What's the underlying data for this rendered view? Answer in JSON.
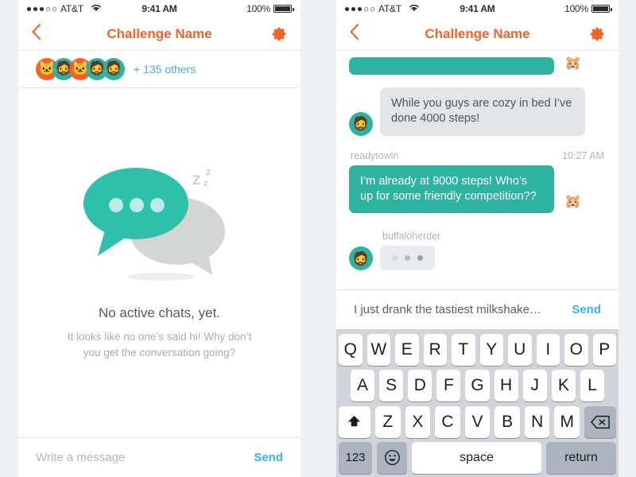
{
  "theme": {
    "accent_orange": "#f4622c",
    "accent_teal": "#2db39f",
    "link_blue": "#35b3f0",
    "others_blue": "#4fa8e8",
    "bubble_gray": "#e4e5e9",
    "page_bg": "#eff0f4",
    "keyboard_bg": "#d1d4db"
  },
  "status_bar": {
    "carrier": "AT&T",
    "signal_filled": 3,
    "signal_hollow": 2,
    "wifi_icon": "wifi-icon",
    "time": "9:41 AM",
    "battery_percent": "100%",
    "battery_icon": "battery-full-icon"
  },
  "nav": {
    "back_icon": "chevron-left-icon",
    "title": "Challenge Name",
    "settings_icon": "gear-icon"
  },
  "left_screen": {
    "participants": {
      "avatars": [
        {
          "ring": "orange",
          "glyph": "🐱"
        },
        {
          "ring": "teal",
          "glyph": "🧔"
        },
        {
          "ring": "orange",
          "glyph": "🐱"
        },
        {
          "ring": "teal",
          "glyph": "🧔"
        },
        {
          "ring": "teal",
          "glyph": "🧔"
        }
      ],
      "others_label": "+ 135 others"
    },
    "empty_state": {
      "illustration": "two-speech-bubbles-sleeping",
      "sleep_marks": [
        "z",
        "Z",
        "z"
      ],
      "title": "No active chats, yet.",
      "subtitle": "It looks like no one’s said hi! Why don’t you get the conversation going?"
    },
    "composer": {
      "placeholder": "Write a message",
      "value": "",
      "send_label": "Send"
    }
  },
  "right_screen": {
    "messages": [
      {
        "type": "outgoing-cut",
        "side": "right",
        "text": "",
        "avatar_glyph": "🐹",
        "bubble_color": "teal"
      },
      {
        "type": "incoming",
        "side": "left",
        "text": "While you guys are cozy in bed I’ve done 4000 steps!",
        "avatar_glyph": "🧔",
        "bubble_color": "gray"
      },
      {
        "type": "incoming-named",
        "side": "left",
        "sender": "readytowin",
        "time": "10:27 AM",
        "text": "I’m already at 9000 steps! Who’s up for some friendly competition??",
        "avatar_glyph": "🐹",
        "bubble_color": "teal"
      },
      {
        "type": "typing",
        "side": "left",
        "sender": "buffaloherder",
        "avatar_glyph": "🧔",
        "dots": [
          "#d5d7dc",
          "#b8bcc4",
          "#9aa0aa"
        ]
      }
    ],
    "composer": {
      "placeholder": "Write a message",
      "value": "I just drank the tastiest milkshake…",
      "send_label": "Send"
    },
    "keyboard": {
      "row1": [
        "Q",
        "W",
        "E",
        "R",
        "T",
        "Y",
        "U",
        "I",
        "O",
        "P"
      ],
      "row2": [
        "A",
        "S",
        "D",
        "F",
        "G",
        "H",
        "J",
        "K",
        "L"
      ],
      "row3_shift_icon": "shift-arrow-icon",
      "row3": [
        "Z",
        "X",
        "C",
        "V",
        "B",
        "N",
        "M"
      ],
      "row3_backspace_icon": "backspace-icon",
      "numbers_label": "123",
      "emoji_icon": "smiley-icon",
      "space_label": "space",
      "return_label": "return"
    }
  }
}
